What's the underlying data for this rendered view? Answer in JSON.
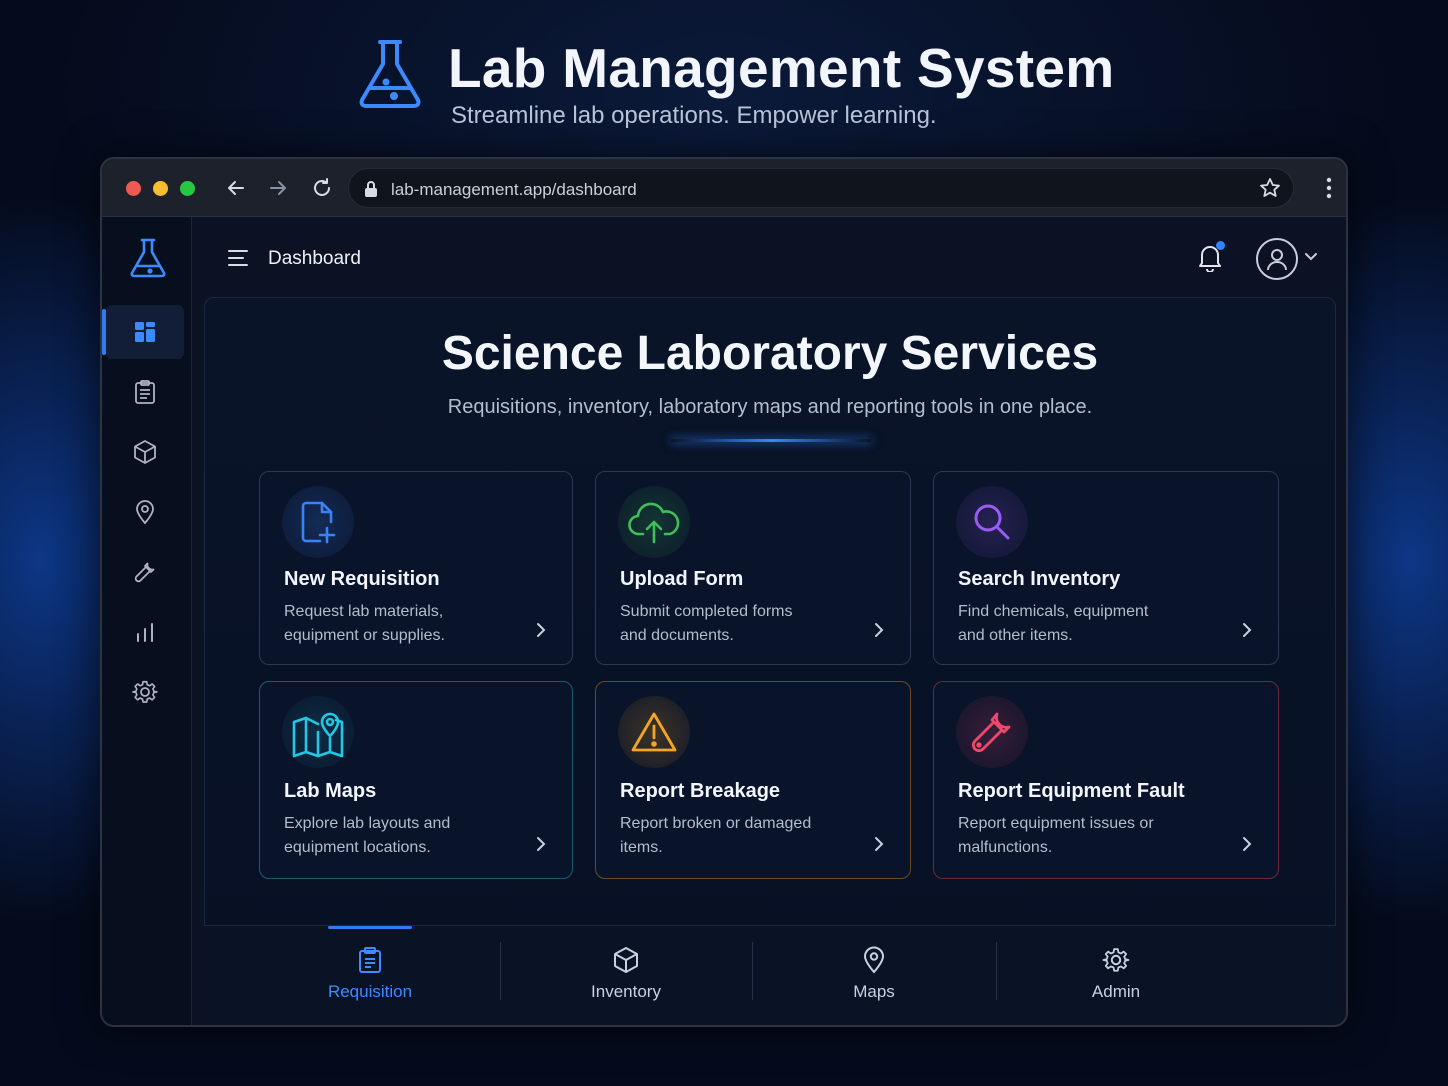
{
  "hero": {
    "title": "Lab Management System",
    "tagline": "Streamline lab operations. Empower learning."
  },
  "browser": {
    "url": "lab-management.app/dashboard"
  },
  "topbar": {
    "page_title": "Dashboard"
  },
  "sidebar": {
    "items": [
      {
        "icon": "dashboard-icon",
        "active": true
      },
      {
        "icon": "clipboard-icon"
      },
      {
        "icon": "cube-icon"
      },
      {
        "icon": "map-pin-icon"
      },
      {
        "icon": "wrench-icon"
      },
      {
        "icon": "bar-chart-icon"
      },
      {
        "icon": "gear-icon"
      }
    ]
  },
  "main": {
    "title": "Science Laboratory Services",
    "subtitle": "Requisitions, inventory, laboratory maps and reporting tools in one place.",
    "cards": [
      {
        "title": "New Requisition",
        "desc": "Request lab materials, equipment or supplies.",
        "icon": "file-plus-icon",
        "accent": "#3b82f6"
      },
      {
        "title": "Upload Form",
        "desc": "Submit completed forms and documents.",
        "icon": "cloud-upload-icon",
        "accent": "#3fbf5a"
      },
      {
        "title": "Search Inventory",
        "desc": "Find chemicals, equipment and other items.",
        "icon": "search-icon",
        "accent": "#9b5cf6"
      },
      {
        "title": "Lab Maps",
        "desc": "Explore lab layouts and equipment locations.",
        "icon": "map-icon",
        "accent": "#22c7e6"
      },
      {
        "title": "Report Breakage",
        "desc": "Report broken or damaged items.",
        "icon": "warning-icon",
        "accent": "#f5a524"
      },
      {
        "title": "Report Equipment Fault",
        "desc": "Report equipment issues or malfunctions.",
        "icon": "wrench-icon",
        "accent": "#f0476c"
      }
    ]
  },
  "tabs": [
    {
      "label": "Requisition",
      "icon": "clipboard-icon",
      "active": true
    },
    {
      "label": "Inventory",
      "icon": "cube-icon"
    },
    {
      "label": "Maps",
      "icon": "map-pin-icon"
    },
    {
      "label": "Admin",
      "icon": "gear-icon"
    }
  ],
  "colors": {
    "accent": "#2f7cf0",
    "background": "#050b1c"
  }
}
